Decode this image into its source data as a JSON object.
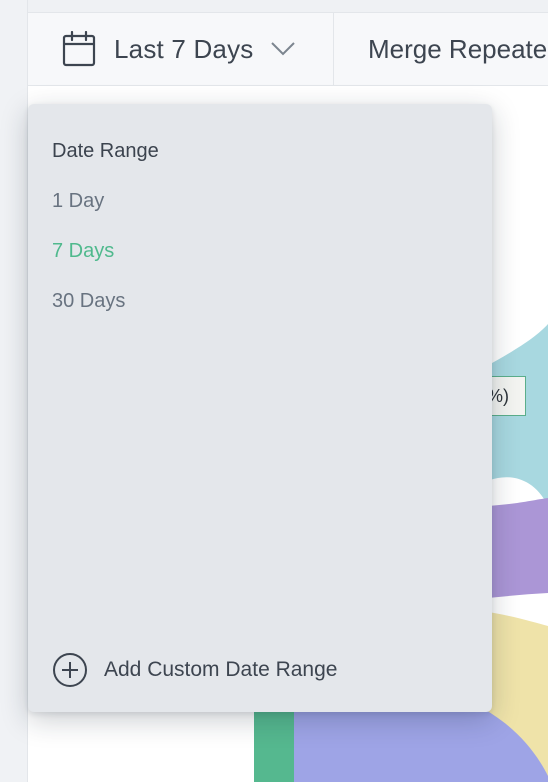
{
  "toolbar": {
    "date_picker": {
      "icon": "calendar-icon",
      "label": "Last 7 Days",
      "chevron_icon": "chevron-down-icon"
    },
    "merge_label": "Merge Repeate"
  },
  "dropdown": {
    "section_title": "Date Range",
    "options": [
      {
        "label": "1 Day",
        "selected": false
      },
      {
        "label": "7 Days",
        "selected": true
      },
      {
        "label": "30 Days",
        "selected": false
      }
    ],
    "custom_range": {
      "icon": "plus-circle-icon",
      "label": "Add Custom Date Range"
    }
  },
  "chart": {
    "visible_tag_text": "%)"
  },
  "colors": {
    "selected_option": "#4fb98d",
    "flow_teal": "#a8d8e0",
    "flow_purple": "#ab96d6",
    "flow_yellow": "#efe3a9",
    "flow_blue": "#9ea4e6",
    "flow_green": "#55b88f"
  }
}
